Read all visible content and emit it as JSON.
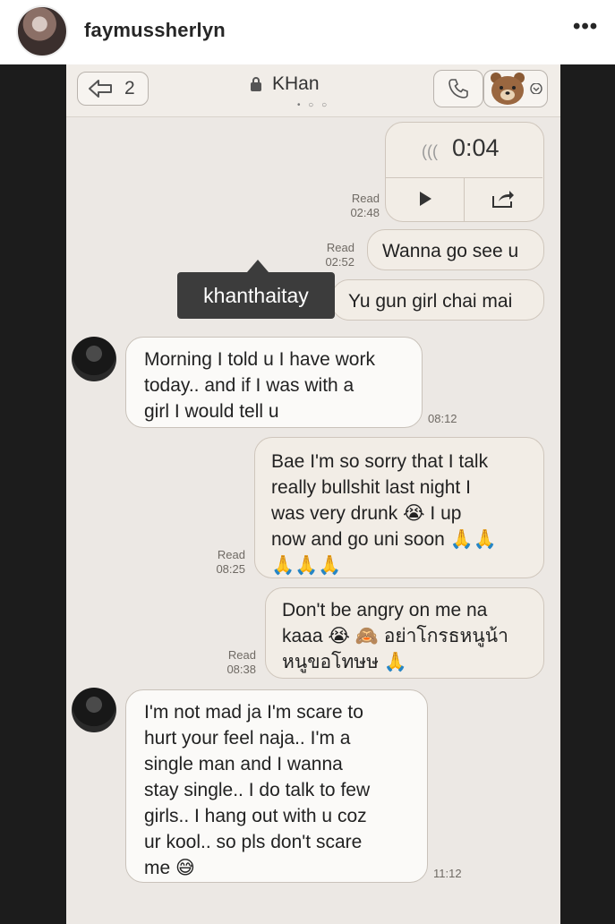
{
  "post": {
    "username": "faymussherlyn",
    "more_icon": "more-horizontal-icon",
    "more_label": "•••"
  },
  "chat": {
    "back_count": "2",
    "title": "KHan",
    "page_dots": "• ○ ○",
    "voice_time": "0:04",
    "voice_waves": "(((",
    "tooltip": "khanthaitay"
  },
  "messages": [
    {
      "id": "m1",
      "side": "out",
      "read": "Read",
      "time": "02:48",
      "type": "voice"
    },
    {
      "id": "m2",
      "side": "out",
      "read": "Read",
      "time": "02:52",
      "text": "Wanna go see u"
    },
    {
      "id": "m3",
      "side": "out",
      "read": "",
      "time": "",
      "text": "Yu gun girl chai mai"
    },
    {
      "id": "m4",
      "side": "in",
      "time": "08:12",
      "lines": [
        "Morning I told u I have work",
        "today.. and if I was with a",
        "girl I would tell u"
      ]
    },
    {
      "id": "m5",
      "side": "out",
      "read": "Read",
      "time": "08:25",
      "lines": [
        "Bae I'm so sorry that I talk",
        "really bullshit last night I",
        "was very drunk 😭  I up",
        "now and go uni soon 🙏🙏",
        "🙏🙏🙏"
      ]
    },
    {
      "id": "m6",
      "side": "out",
      "read": "Read",
      "time": "08:38",
      "lines": [
        "Don't be angry on me na",
        "kaaa 😭 🙈  อย่าโกรธหนูน้า",
        "หนูขอโทษษ 🙏"
      ]
    },
    {
      "id": "m7",
      "side": "in",
      "time": "11:12",
      "lines": [
        " I'm not mad ja I'm scare to",
        "hurt your feel naja.. I'm a",
        "single man and I wanna",
        "stay single.. I do talk to few",
        "girls.. I hang out with u coz",
        "ur kool.. so pls don't scare",
        "me 😅"
      ]
    }
  ],
  "colors": {
    "screen_bg": "#ece8e4",
    "bubble_out": "#f2ede6",
    "bubble_in": "#fbfaf8",
    "tooltip_bg": "#3c3c3c"
  }
}
